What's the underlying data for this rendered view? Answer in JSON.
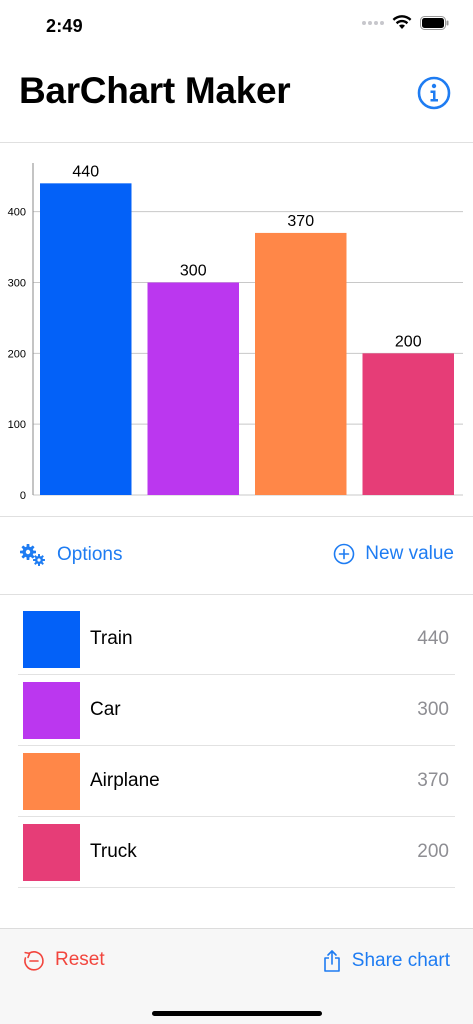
{
  "status_bar": {
    "time": "2:49"
  },
  "nav": {
    "title": "BarChart Maker",
    "info_icon": "info-circle-icon"
  },
  "chart_data": {
    "type": "bar",
    "categories": [
      "Train",
      "Car",
      "Airplane",
      "Truck"
    ],
    "values": [
      440,
      300,
      370,
      200
    ],
    "colors": [
      "#0361f8",
      "#bb37ef",
      "#ff8748",
      "#e63d77"
    ],
    "title": "",
    "xlabel": "",
    "ylabel": "",
    "ylim": [
      0,
      480
    ],
    "yticks": [
      0,
      100,
      200,
      300,
      400
    ],
    "grid": true,
    "data_labels": true
  },
  "toolbar": {
    "options_label": "Options",
    "options_icon": "gears-icon",
    "new_value_label": "New value",
    "new_value_icon": "plus-circle-icon"
  },
  "items": [
    {
      "label": "Train",
      "value": "440",
      "color": "#0361f8"
    },
    {
      "label": "Car",
      "value": "300",
      "color": "#bb37ef"
    },
    {
      "label": "Airplane",
      "value": "370",
      "color": "#ff8748"
    },
    {
      "label": "Truck",
      "value": "200",
      "color": "#e63d77"
    }
  ],
  "bottom_bar": {
    "reset_label": "Reset",
    "reset_icon": "reset-circle-icon",
    "share_label": "Share chart",
    "share_icon": "share-icon"
  },
  "colors": {
    "accent": "#1e7cf2",
    "destructive": "#f2453d",
    "secondary_text": "#8e8e93"
  }
}
